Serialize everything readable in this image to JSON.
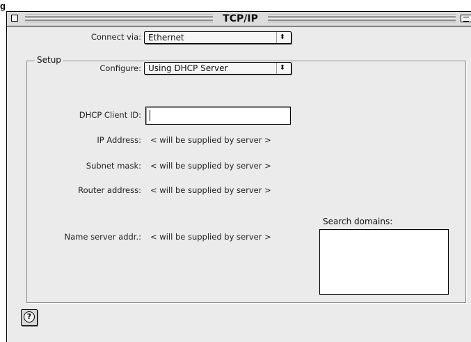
{
  "figure_label": "g",
  "window": {
    "title": "TCP/IP"
  },
  "connect": {
    "label": "Connect via:",
    "value": "Ethernet"
  },
  "setup": {
    "group_label": "Setup",
    "configure_label": "Configure:",
    "configure_value": "Using DHCP Server",
    "dhcp_client_id_label": "DHCP Client ID:",
    "dhcp_client_id_value": "",
    "ip_label": "IP Address:",
    "ip_value": "< will be supplied by server >",
    "subnet_label": "Subnet mask:",
    "subnet_value": "< will be supplied by server >",
    "router_label": "Router address:",
    "router_value": "< will be supplied by server >",
    "nameserver_label": "Name server addr.:",
    "nameserver_value": "< will be supplied by server >",
    "search_domains_label": "Search domains:",
    "search_domains_value": ""
  },
  "icons": {
    "popup_arrow": "updown-arrows-icon",
    "help": "help-icon"
  }
}
